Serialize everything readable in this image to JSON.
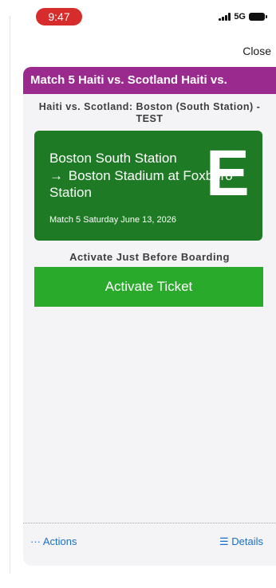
{
  "status_bar": {
    "time": "9:47",
    "network": "5G"
  },
  "header": {
    "close_label": "Close"
  },
  "ticket": {
    "banner": "Match 5 Haiti vs. Scotland Haiti vs.",
    "event_title": "Haiti vs. Scotland: Boston (South Station) - TEST",
    "route_origin": "Boston South Station",
    "arrow": "→",
    "route_dest": "Boston Stadium at Foxboro Station",
    "zone": "E",
    "date_line": "Match 5 Saturday June 13, 2026",
    "activate_hint": "Activate Just Before Boarding",
    "activate_label": "Activate Ticket"
  },
  "footer": {
    "actions_label": "··· Actions",
    "details_label": "☰ Details"
  },
  "colors": {
    "banner": "#9b2a8f",
    "ticket": "#1f7a25",
    "activate": "#2aaa2a",
    "time_pill": "#d62c2c",
    "link": "#1a6fc8"
  }
}
